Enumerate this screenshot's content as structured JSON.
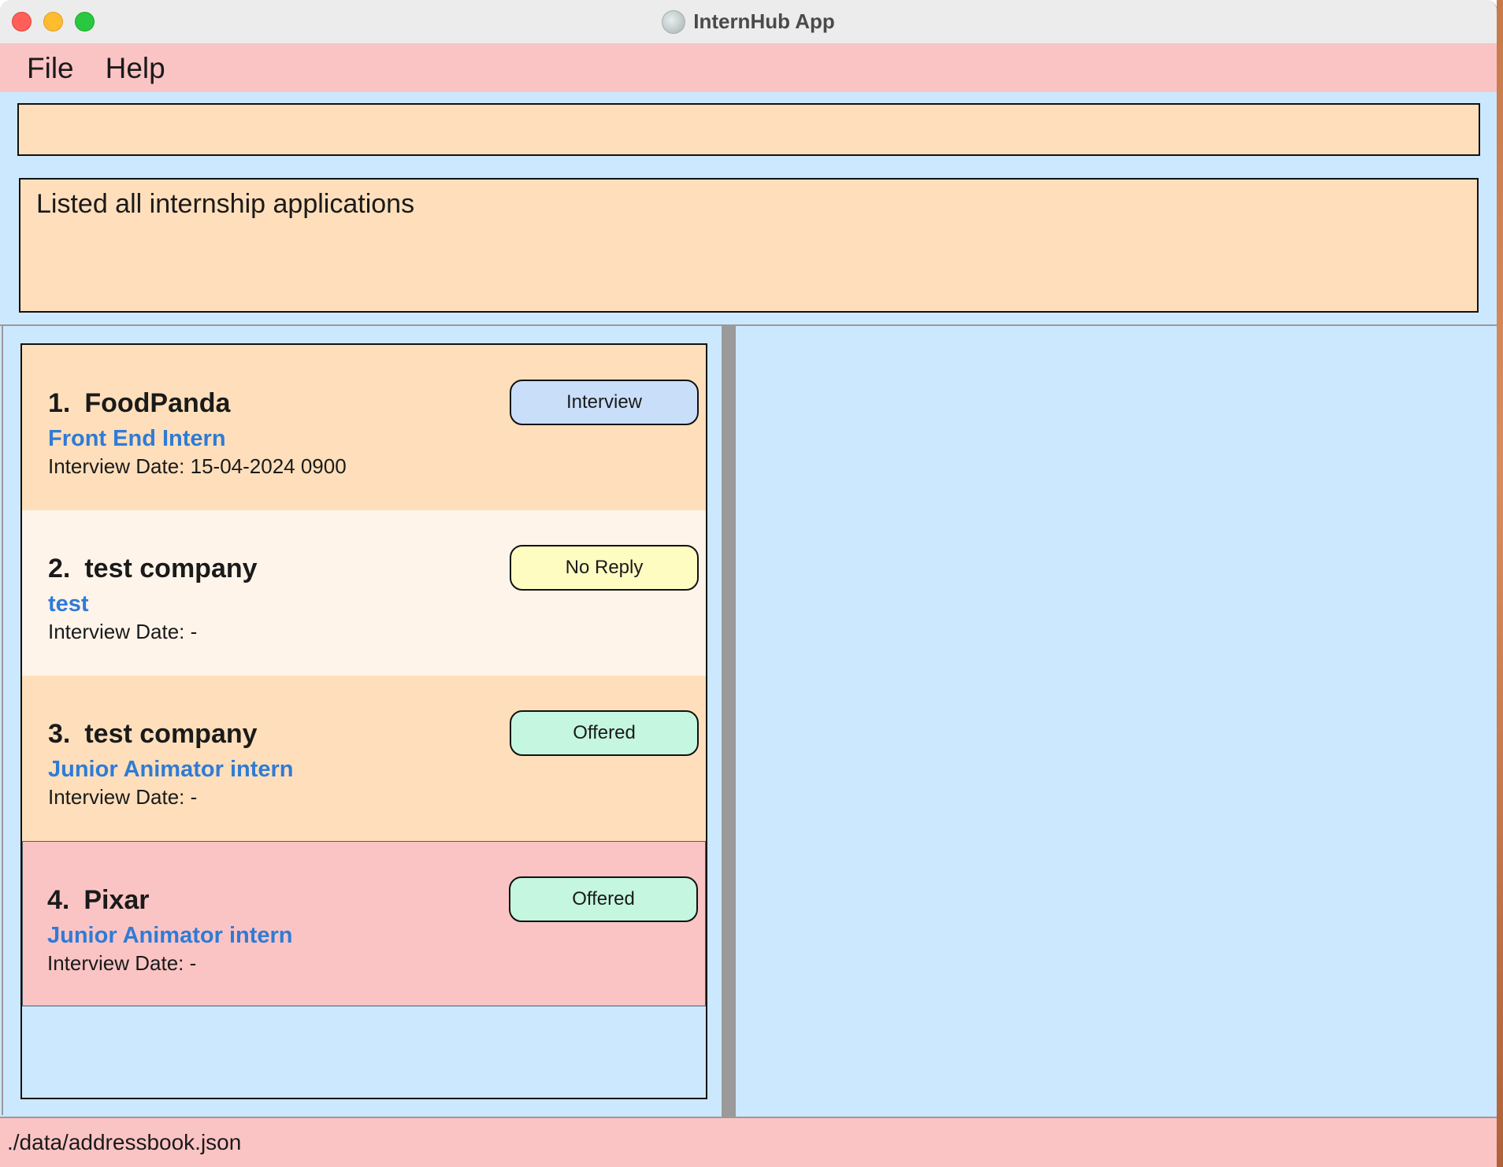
{
  "window": {
    "title": "InternHub App"
  },
  "menu": {
    "file": "File",
    "help": "Help"
  },
  "command_box": {
    "value": "",
    "placeholder": ""
  },
  "result_display": {
    "text": "Listed all internship applications"
  },
  "applications": [
    {
      "index": "1.",
      "company": "FoodPanda",
      "role": "Front End Intern",
      "interview_date": "Interview Date: 15-04-2024 0900",
      "status": "Interview",
      "status_color": "#c9def9"
    },
    {
      "index": "2.",
      "company": "test company",
      "role": "test",
      "interview_date": "Interview Date: -",
      "status": "No Reply",
      "status_color": "#fffcc2"
    },
    {
      "index": "3.",
      "company": "test company",
      "role": "Junior Animator intern",
      "interview_date": "Interview Date: -",
      "status": "Offered",
      "status_color": "#c4f6e0"
    },
    {
      "index": "4.",
      "company": "Pixar",
      "role": "Junior Animator intern",
      "interview_date": "Interview Date: -",
      "status": "Offered",
      "status_color": "#c4f6e0"
    }
  ],
  "status_bar": {
    "path": "./data/addressbook.json"
  },
  "colors": {
    "background": "#cce8ff",
    "menu_bar": "#fbc4c4",
    "card_odd": "#ffdfbb",
    "card_even": "#fff4ea",
    "card_selected": "#fbc4c4",
    "role_text": "#2f7bd6"
  }
}
